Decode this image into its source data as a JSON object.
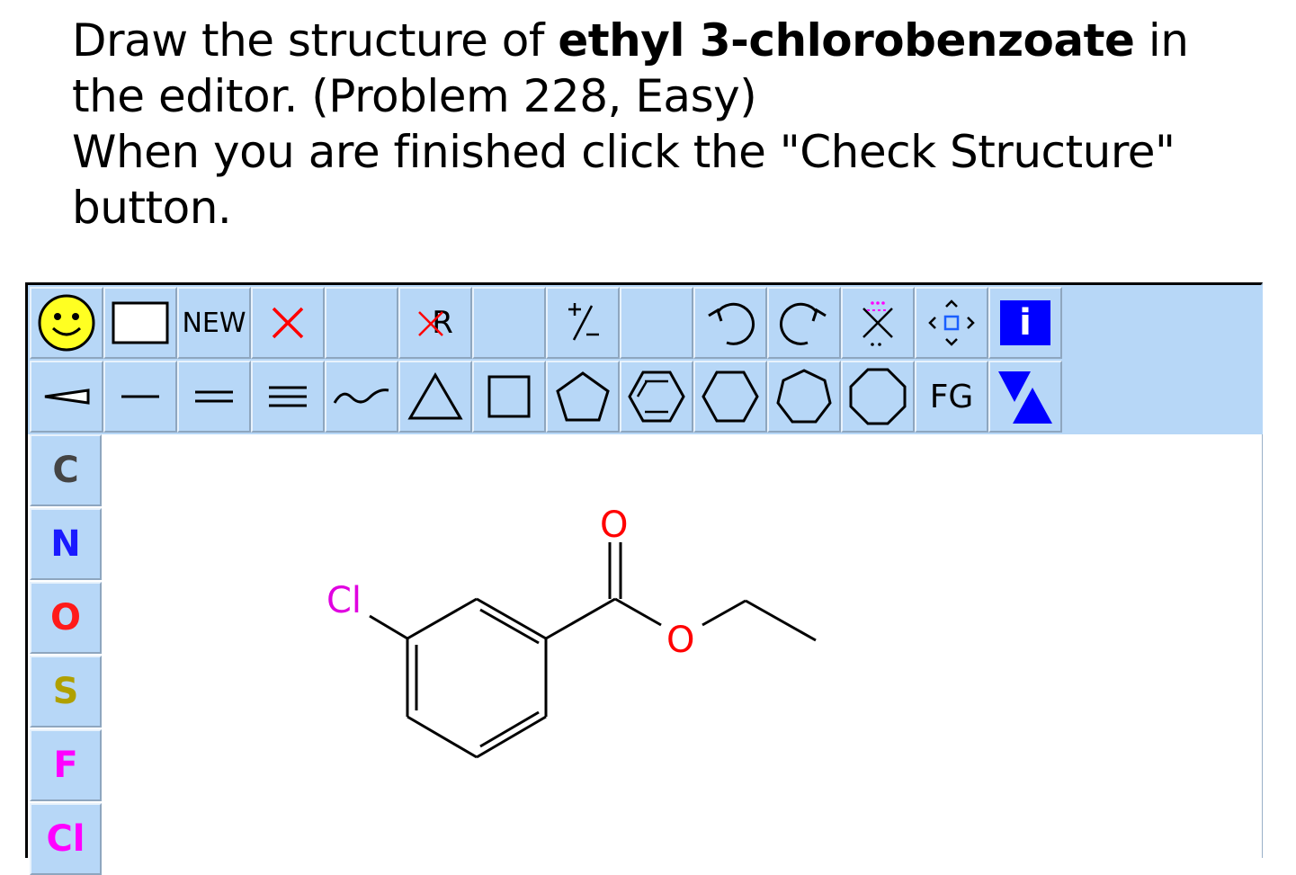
{
  "instructions": {
    "line1_pre": "Draw the structure of ",
    "compound": "ethyl 3-chlorobenzoate",
    "line1_post": " in",
    "line2": "the editor. (Problem 228, Easy)",
    "line3": "When you are finished click the \"Check Structure\"",
    "line4": "button."
  },
  "toolbar": {
    "new_label": "NEW",
    "rgroup_label": "R",
    "charge_label": "+/−",
    "fg_label": "FG",
    "info_label": "i"
  },
  "atoms": [
    {
      "symbol": "C",
      "color": "#444444"
    },
    {
      "symbol": "N",
      "color": "#1a1aff"
    },
    {
      "symbol": "O",
      "color": "#ff1a1a"
    },
    {
      "symbol": "S",
      "color": "#b0a000"
    },
    {
      "symbol": "F",
      "color": "#ff00ff"
    },
    {
      "symbol": "Cl",
      "color": "#ff00ff"
    }
  ],
  "molecule": {
    "labels": {
      "chlorine": "Cl",
      "carbonyl_oxygen": "O",
      "ester_oxygen": "O"
    },
    "colors": {
      "chlorine": "#e000e0",
      "oxygen": "#ff0000",
      "bond": "#000000"
    }
  }
}
